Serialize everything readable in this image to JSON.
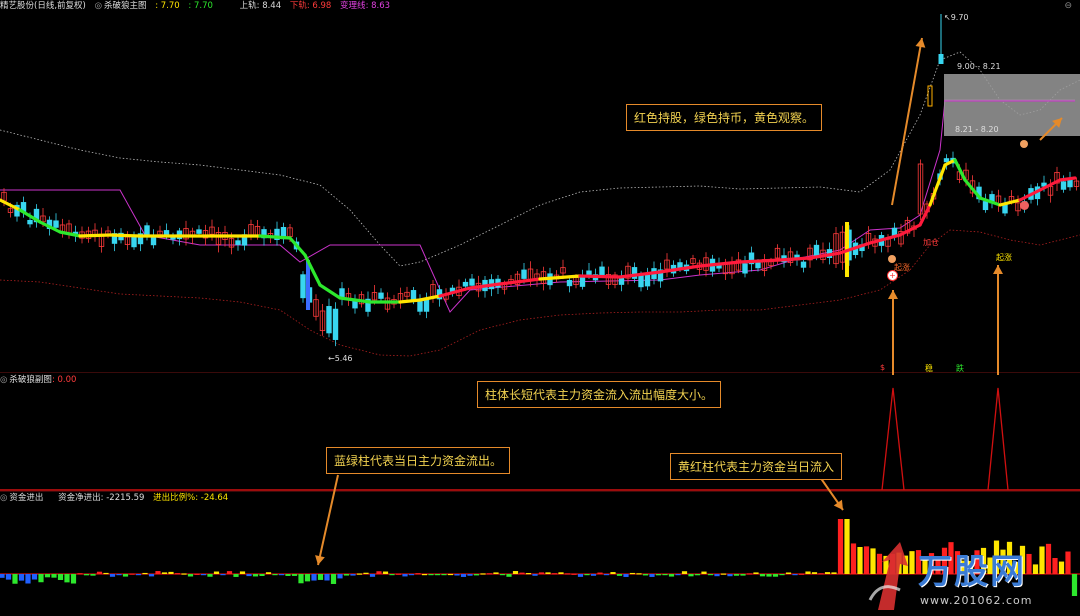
{
  "main_panel": {
    "stock_name": "精艺股份",
    "period": "(日线,前复权)",
    "indicator": "杀破狼主图",
    "value1": ": 7.70",
    "value2": ": 7.70",
    "upper_label": "上轨",
    "upper_value": ": 8.44",
    "lower_label": "下轨",
    "lower_value": ": 6.98",
    "change_label": "变理线",
    "change_value": ": 8.63",
    "high_label": "9.70",
    "low_label": "5.46",
    "range_top": "9.00 - 8.21",
    "range_bottom": "8.21 - 8.20",
    "marks": [
      "起涨",
      "加仓",
      "起涨"
    ]
  },
  "sub_panel": {
    "indicator": "杀破狼副图",
    "value": ": 0.00",
    "top_marks": [
      "$",
      "稳",
      "跌"
    ]
  },
  "money_panel": {
    "indicator": "资金进出",
    "net_label": "资金净进出",
    "net_value": ": -2215.59",
    "ratio_label": "进出比例%",
    "ratio_value": ": -24.64"
  },
  "annotations": {
    "red_green": "红色持股，绿色持币，黄色观察。",
    "bar_length": "柱体长短代表主力资金流入流出幅度大小。",
    "blue_green": "蓝绿柱代表当日主力资金流出。",
    "yellow_red": "黄红柱代表主力资金当日流入"
  },
  "watermark": {
    "brand": "万股网",
    "url": "www.201062.com"
  },
  "colors": {
    "rise": "#ff3b3b",
    "fall": "#38d6f0",
    "ma_red": "#ff1a3c",
    "ma_green": "#2de82d",
    "ma_yellow": "#ffe600",
    "channel": "#cc33cc",
    "annotation_border": "#e58a2a",
    "annotation_text": "#f2d250"
  }
}
